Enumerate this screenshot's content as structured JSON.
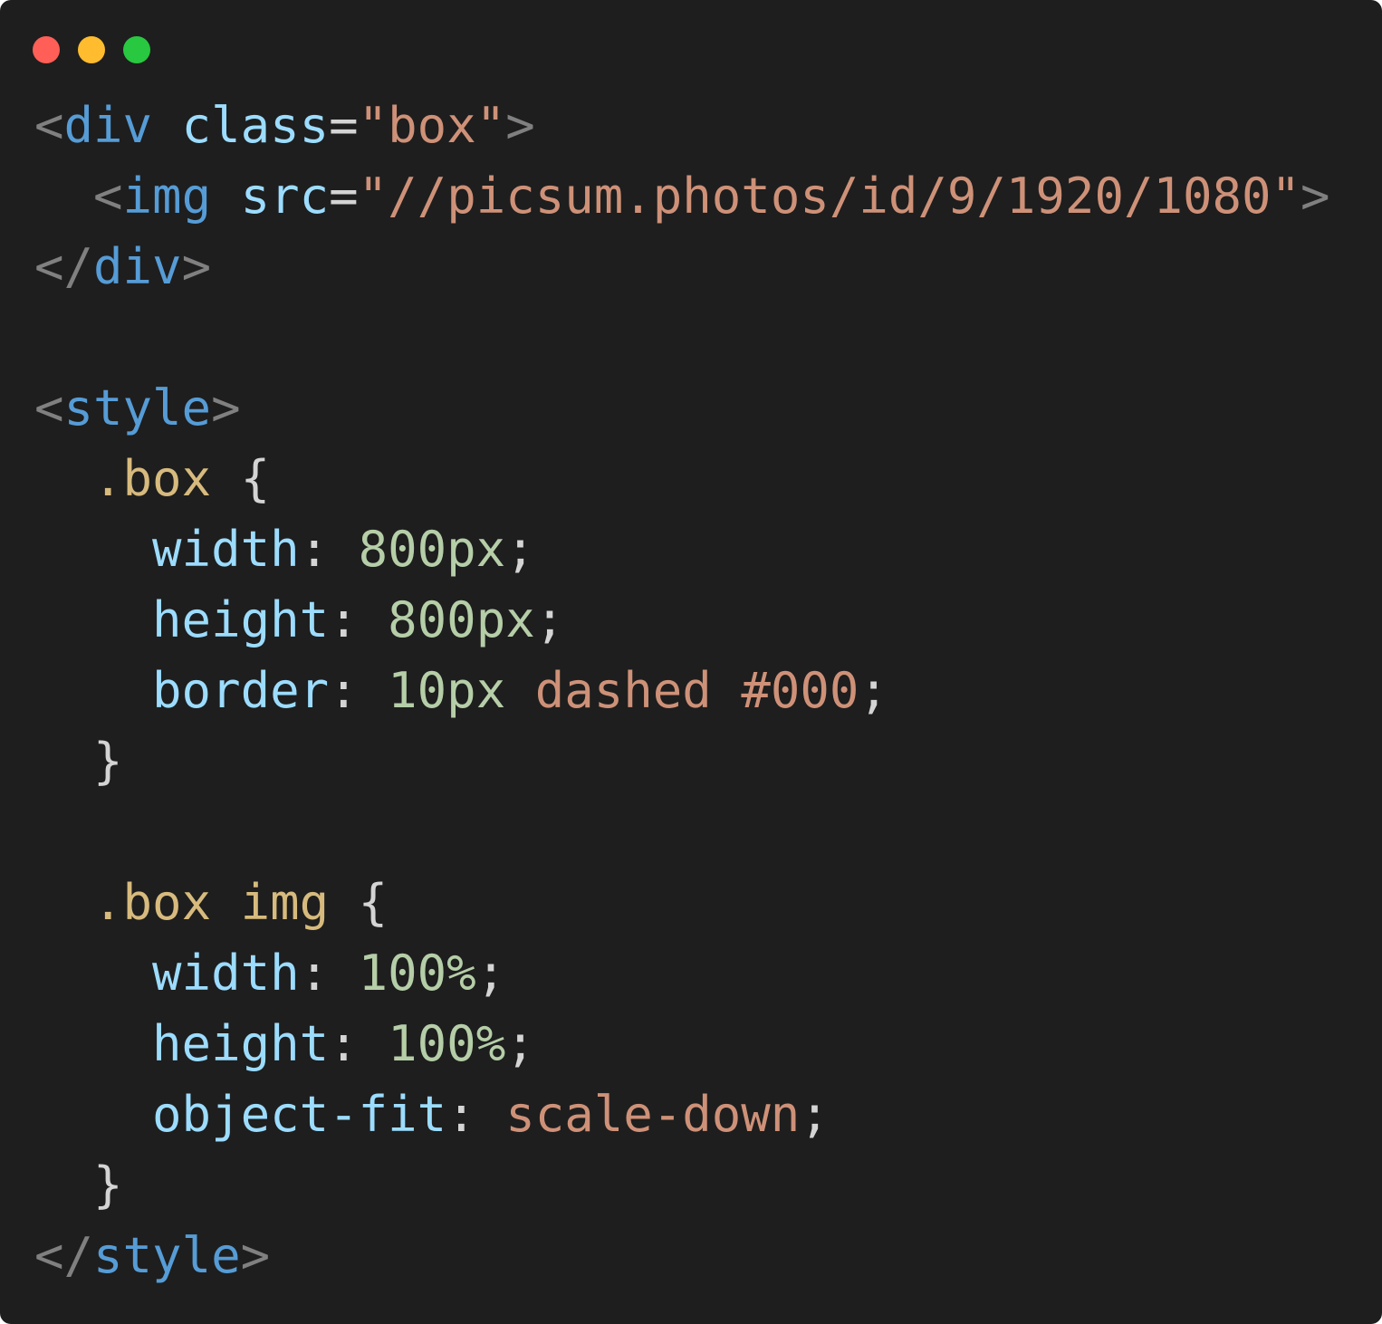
{
  "window": {
    "controls": [
      {
        "name": "close",
        "color": "#ff5f57"
      },
      {
        "name": "minimize",
        "color": "#febc2e"
      },
      {
        "name": "maximize",
        "color": "#28c840"
      }
    ]
  },
  "code": {
    "lines": [
      [
        [
          "punct",
          "<"
        ],
        [
          "tag",
          "div"
        ],
        [
          "plain",
          " "
        ],
        [
          "attr",
          "class"
        ],
        [
          "eq",
          "="
        ],
        [
          "str",
          "\"box\""
        ],
        [
          "punct",
          ">"
        ]
      ],
      [
        [
          "plain",
          "  "
        ],
        [
          "punct",
          "<"
        ],
        [
          "tag",
          "img"
        ],
        [
          "plain",
          " "
        ],
        [
          "attr",
          "src"
        ],
        [
          "eq",
          "="
        ],
        [
          "str",
          "\"//picsum.photos/id/9/1920/1080\""
        ],
        [
          "punct",
          ">"
        ]
      ],
      [
        [
          "punct",
          "</"
        ],
        [
          "tag",
          "div"
        ],
        [
          "punct",
          ">"
        ]
      ],
      [],
      [
        [
          "punct",
          "<"
        ],
        [
          "tag",
          "style"
        ],
        [
          "punct",
          ">"
        ]
      ],
      [
        [
          "plain",
          "  "
        ],
        [
          "sel",
          ".box"
        ],
        [
          "plain",
          " {"
        ]
      ],
      [
        [
          "plain",
          "    "
        ],
        [
          "prop",
          "width"
        ],
        [
          "plain",
          ": "
        ],
        [
          "num",
          "800px"
        ],
        [
          "plain",
          ";"
        ]
      ],
      [
        [
          "plain",
          "    "
        ],
        [
          "prop",
          "height"
        ],
        [
          "plain",
          ": "
        ],
        [
          "num",
          "800px"
        ],
        [
          "plain",
          ";"
        ]
      ],
      [
        [
          "plain",
          "    "
        ],
        [
          "prop",
          "border"
        ],
        [
          "plain",
          ": "
        ],
        [
          "num",
          "10px"
        ],
        [
          "plain",
          " "
        ],
        [
          "str",
          "dashed"
        ],
        [
          "plain",
          " "
        ],
        [
          "str",
          "#000"
        ],
        [
          "plain",
          ";"
        ]
      ],
      [
        [
          "plain",
          "  }"
        ]
      ],
      [],
      [
        [
          "plain",
          "  "
        ],
        [
          "sel",
          ".box img"
        ],
        [
          "plain",
          " {"
        ]
      ],
      [
        [
          "plain",
          "    "
        ],
        [
          "prop",
          "width"
        ],
        [
          "plain",
          ": "
        ],
        [
          "num",
          "100%"
        ],
        [
          "plain",
          ";"
        ]
      ],
      [
        [
          "plain",
          "    "
        ],
        [
          "prop",
          "height"
        ],
        [
          "plain",
          ": "
        ],
        [
          "num",
          "100%"
        ],
        [
          "plain",
          ";"
        ]
      ],
      [
        [
          "plain",
          "    "
        ],
        [
          "prop",
          "object-fit"
        ],
        [
          "plain",
          ": "
        ],
        [
          "str",
          "scale-down"
        ],
        [
          "plain",
          ";"
        ]
      ],
      [
        [
          "plain",
          "  }"
        ]
      ],
      [
        [
          "punct",
          "</"
        ],
        [
          "tag",
          "style"
        ],
        [
          "punct",
          ">"
        ]
      ]
    ]
  }
}
